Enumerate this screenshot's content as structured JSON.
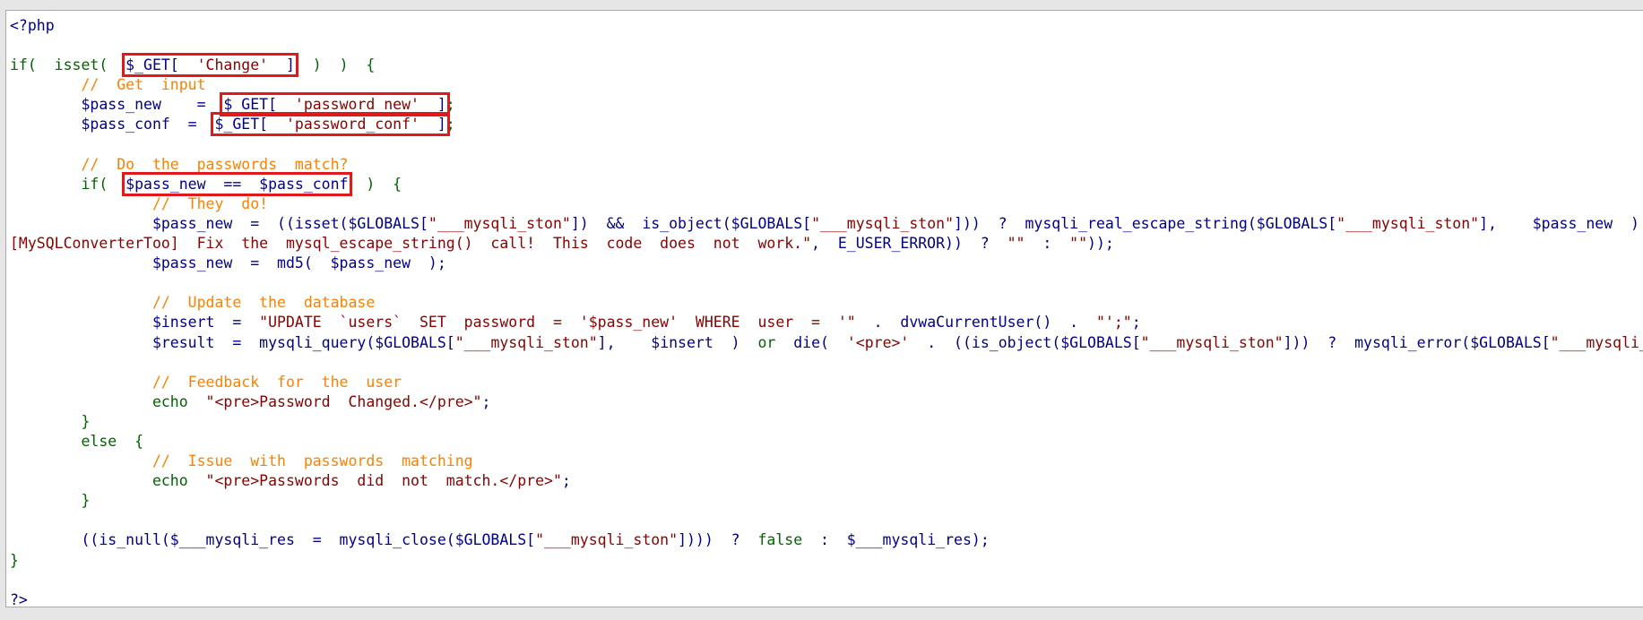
{
  "code": {
    "lines": [
      [
        {
          "t": "pl",
          "v": "<?php"
        }
      ],
      [],
      [
        {
          "t": "kw",
          "v": "if(  isset(  "
        },
        {
          "t": "hl",
          "v": "$_GET[  'Change'  ]"
        },
        {
          "t": "kw",
          "v": "  )  )  {"
        }
      ],
      [
        {
          "t": "cm",
          "v": "        //  Get  input"
        }
      ],
      [
        {
          "t": "vr",
          "v": "        $pass_new    =  "
        },
        {
          "t": "hl",
          "v": "$_GET[  'password_new'  ]"
        },
        {
          "t": "op",
          "v": ";"
        }
      ],
      [
        {
          "t": "vr",
          "v": "        $pass_conf  =  "
        },
        {
          "t": "hl",
          "v": "$_GET[  'password_conf'  ]"
        },
        {
          "t": "op",
          "v": ";"
        }
      ],
      [],
      [
        {
          "t": "cm",
          "v": "        //  Do  the  passwords  match?"
        }
      ],
      [
        {
          "t": "kw",
          "v": "        if(  "
        },
        {
          "t": "hl",
          "v": "$pass_new  ==  $pass_conf"
        },
        {
          "t": "kw",
          "v": "  )  {"
        }
      ],
      [
        {
          "t": "cm",
          "v": "                //  They  do!"
        }
      ],
      [
        {
          "t": "vr",
          "v": "                $pass_new  =  ((isset($GLOBALS["
        },
        {
          "t": "st",
          "v": "\"___mysqli_ston\""
        },
        {
          "t": "vr",
          "v": "])  &&  is_object($GLOBALS["
        },
        {
          "t": "st",
          "v": "\"___mysqli_ston\""
        },
        {
          "t": "vr",
          "v": "]))  ?  mysqli_real_escape_string($GLOBALS["
        },
        {
          "t": "st",
          "v": "\"___mysqli_ston\""
        },
        {
          "t": "vr",
          "v": "],    $pass_new  )  :  ((trigger_error(\"[MySQLConverterToo]"
        }
      ],
      [
        {
          "t": "st",
          "v": "[MySQLConverterToo]  Fix  the  mysql_escape_string()  call!  This  code  does  not  work.\""
        },
        {
          "t": "vr",
          "v": ",  E_USER_ERROR))  ?  "
        },
        {
          "t": "st",
          "v": "\"\""
        },
        {
          "t": "vr",
          "v": "  :  "
        },
        {
          "t": "st",
          "v": "\"\""
        },
        {
          "t": "vr",
          "v": "));"
        }
      ],
      [
        {
          "t": "vr",
          "v": "                $pass_new  =  md5(  $pass_new  );"
        }
      ],
      [],
      [
        {
          "t": "cm",
          "v": "                //  Update  the  database"
        }
      ],
      [
        {
          "t": "vr",
          "v": "                $insert  =  "
        },
        {
          "t": "st",
          "v": "\"UPDATE  `users`  SET  password  =  '$pass_new'  WHERE  user  =  '\""
        },
        {
          "t": "vr",
          "v": "  .  dvwaCurrentUser()  .  "
        },
        {
          "t": "st",
          "v": "\"';\""
        },
        {
          "t": "vr",
          "v": ";"
        }
      ],
      [
        {
          "t": "vr",
          "v": "                $result  =  mysqli_query($GLOBALS["
        },
        {
          "t": "st",
          "v": "\"___mysqli_ston\""
        },
        {
          "t": "vr",
          "v": "],    $insert  )  "
        },
        {
          "t": "kw",
          "v": "or"
        },
        {
          "t": "vr",
          "v": "  die(  "
        },
        {
          "t": "st",
          "v": "'<pre>'"
        },
        {
          "t": "vr",
          "v": "  .  ((is_object($GLOBALS["
        },
        {
          "t": "st",
          "v": "\"___mysqli_ston\""
        },
        {
          "t": "vr",
          "v": "]))  ?  mysqli_error($GLOBALS["
        },
        {
          "t": "st",
          "v": "\"___mysqli_ston\""
        },
        {
          "t": "vr",
          "v": "])  :"
        }
      ],
      [],
      [
        {
          "t": "cm",
          "v": "                //  Feedback  for  the  user"
        }
      ],
      [
        {
          "t": "kw",
          "v": "                echo  "
        },
        {
          "t": "st",
          "v": "\"<pre>Password  Changed.</pre>\""
        },
        {
          "t": "vr",
          "v": ";"
        }
      ],
      [
        {
          "t": "kw",
          "v": "        }"
        }
      ],
      [
        {
          "t": "kw",
          "v": "        else  {"
        }
      ],
      [
        {
          "t": "cm",
          "v": "                //  Issue  with  passwords  matching"
        }
      ],
      [
        {
          "t": "kw",
          "v": "                echo  "
        },
        {
          "t": "st",
          "v": "\"<pre>Passwords  did  not  match.</pre>\""
        },
        {
          "t": "vr",
          "v": ";"
        }
      ],
      [
        {
          "t": "kw",
          "v": "        }"
        }
      ],
      [],
      [
        {
          "t": "vr",
          "v": "        ((is_null($___mysqli_res  =  mysqli_close($GLOBALS["
        },
        {
          "t": "st",
          "v": "\"___mysqli_ston\""
        },
        {
          "t": "vr",
          "v": "])))  ?  "
        },
        {
          "t": "kw",
          "v": "false"
        },
        {
          "t": "vr",
          "v": "  :  $___mysqli_res);"
        }
      ],
      [
        {
          "t": "kw",
          "v": "}"
        }
      ],
      [],
      [
        {
          "t": "pl",
          "v": "?>"
        }
      ]
    ]
  },
  "colors": {
    "keyword": "#006400",
    "variable": "#00008b",
    "string": "#8b0000",
    "comment": "#ff8000",
    "highlight_box": "#e0191c"
  }
}
